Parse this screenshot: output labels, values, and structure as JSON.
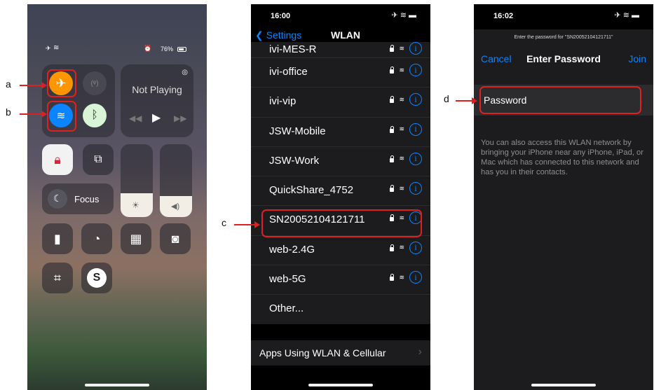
{
  "annotations": {
    "a": "a",
    "b": "b",
    "c": "c",
    "d": "d"
  },
  "control_center": {
    "battery": "76%",
    "now_playing": "Not Playing",
    "focus_label": "Focus",
    "airplane_color": "#ff9500",
    "wifi_color": "#0a84ff"
  },
  "wlan_screen": {
    "time": "16:00",
    "back_label": "Settings",
    "title": "WLAN",
    "networks": [
      "ivi-MES-R",
      "ivi-office",
      "ivi-vip",
      "JSW-Mobile",
      "JSW-Work",
      "QuickShare_4752",
      "SN20052104121711",
      "web-2.4G",
      "web-5G"
    ],
    "other_label": "Other...",
    "apps_label": "Apps Using WLAN & Cellular"
  },
  "password_screen": {
    "time": "16:02",
    "prompt": "Enter the password for \"SN20052104121711\"",
    "cancel_label": "Cancel",
    "title": "Enter Password",
    "join_label": "Join",
    "password_placeholder": "Password",
    "help_text": "You can also access this WLAN network by bringing your iPhone near any iPhone, iPad, or Mac which has connected to this network and has you in their contacts."
  }
}
